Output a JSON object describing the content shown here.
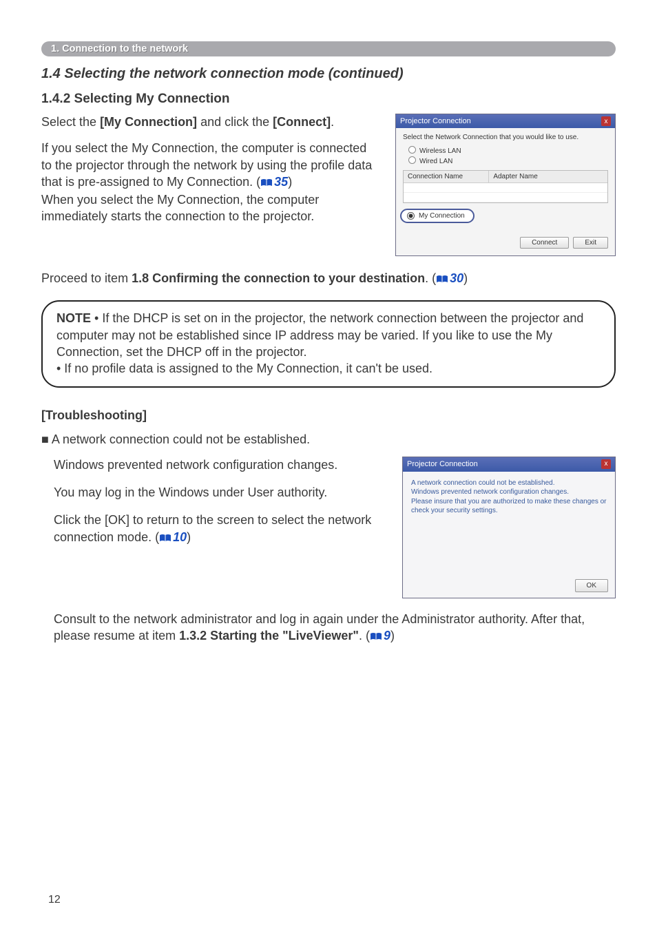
{
  "section_pill": "1. Connection to the network",
  "h_continued": "1.4 Selecting the network connection mode (continued)",
  "h_sub": "1.4.2 Selecting My Connection",
  "intro": {
    "p1_pre": "Select the ",
    "p1_bold1": "[My Connection]",
    "p1_mid": " and click the ",
    "p1_bold2": "[Connect]",
    "p1_post": ".",
    "p2a": "If you select the My Connection, the computer is connected to the projector through the network by using the profile data that is pre-assigned to My Connection. (",
    "ref35": "35",
    "p2b": ")",
    "p2c": "When you select the My Connection, the computer immediately starts the connection to the projector."
  },
  "dialog1": {
    "title": "Projector Connection",
    "close": "x",
    "prompt": "Select the Network Connection that you would like to use.",
    "radio1": "Wireless LAN",
    "radio2": "Wired LAN",
    "th1": "Connection Name",
    "th2": "Adapter Name",
    "myconn": "My Connection",
    "btn_connect": "Connect",
    "btn_exit": "Exit"
  },
  "proceed": {
    "pre": "Proceed to item ",
    "bold": "1.8 Confirming the connection to your destination",
    "post": ". (",
    "ref": "30",
    "end": ")"
  },
  "note": {
    "label": "NOTE",
    "t1": "  • If the DHCP is set on in the projector, the network connection between the projector and computer may not be established since IP address may be varied. If you like to use the My Connection, set the DHCP off in the projector.",
    "t2": "• If no profile data is assigned to the My Connection, it can't be used."
  },
  "trouble": {
    "heading": "[Troubleshooting]",
    "lead": "A network connection could not be established.",
    "p1": "Windows prevented network configuration changes.",
    "p2": "You may log in the Windows under User authority.",
    "p3a": "Click the ",
    "p3bold": "[OK]",
    "p3b": " to return to the screen to select the network connection mode. (",
    "ref10": "10",
    "p3c": ")"
  },
  "dialog2": {
    "title": "Projector Connection",
    "close": "x",
    "l1": "A network connection could not be established.",
    "l2": "Windows prevented network configuration changes.",
    "l3": "Please insure that you are authorized to make these changes or check your security settings.",
    "btn_ok": "OK"
  },
  "consult": {
    "t1": "Consult to the network administrator and log in again under the Administrator authority. After that, please resume at item ",
    "bold": "1.3.2 Starting the \"LiveViewer\"",
    "t2": ". (",
    "ref9": "9",
    "t3": ")"
  },
  "page_number": "12"
}
